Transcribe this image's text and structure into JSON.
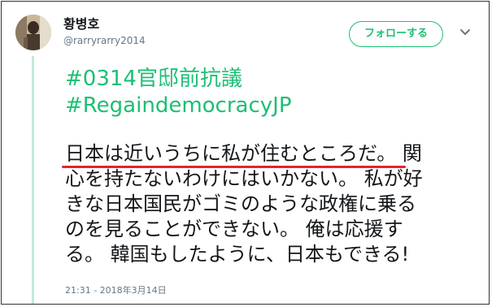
{
  "user": {
    "display_name": "황병호",
    "handle": "@rarryrarry2014"
  },
  "follow_button": {
    "label": "フォローする"
  },
  "tweet": {
    "hashtags": [
      "#0314官邸前抗議",
      "#RegaindemocracyJP"
    ],
    "lines": [
      {
        "underlined": "日本は近いうちに私が住むところだ。",
        "rest": " 関"
      },
      {
        "text": "心を持たないわけにはいかない。 私が好"
      },
      {
        "text": "きな日本国民がゴミのような政権に乗る"
      },
      {
        "text": "のを見ることができない。 俺は応援す"
      },
      {
        "text": "る。 韓国もしたように、日本もできる!"
      }
    ],
    "timestamp": "21:31 - 2018年3月14日"
  },
  "colors": {
    "accent": "#1dbf73",
    "thread_line": "#c5ead9",
    "underline": "#e0262b",
    "text": "#14171a",
    "muted": "#657786"
  },
  "icons": {
    "caret": "chevron-down-icon"
  }
}
